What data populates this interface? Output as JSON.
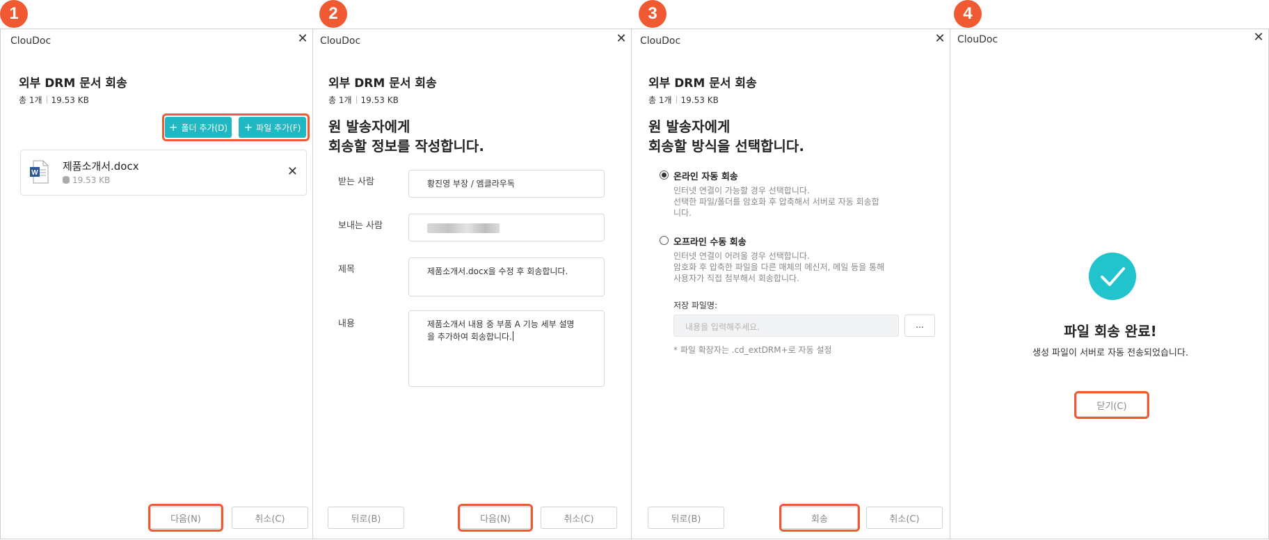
{
  "steps": [
    "1",
    "2",
    "3",
    "4"
  ],
  "app_title": "ClouDoc",
  "close_glyph": "✕",
  "dialog_title": "외부 DRM 문서 회송",
  "summary": {
    "count": "총 1개",
    "size": "19.53 KB"
  },
  "panel1": {
    "add_folder": "폴더 추가(D)",
    "add_file": "파일 추가(F)",
    "file": {
      "name": "제품소개서.docx",
      "size": "19.53 KB",
      "icon": "word-doc-icon"
    },
    "next": "다음(N)",
    "cancel": "취소(C)"
  },
  "panel2": {
    "heading_line1": "원 발송자에게",
    "heading_line2": "회송할 정보를 작성합니다.",
    "fields": [
      {
        "label": "받는 사람",
        "value": "황진영 부장 / 엠클라우독"
      },
      {
        "label": "보내는 사람",
        "value": ""
      },
      {
        "label": "제목",
        "value": "제품소개서.docx을 수정 후 회송합니다."
      },
      {
        "label": "내용",
        "value_line1": "제품소개서 내용 중 부품 A 기능 세부 설명",
        "value_line2": "을 추가하여 회송합니다."
      }
    ],
    "back": "뒤로(B)",
    "next": "다음(N)",
    "cancel": "취소(C)"
  },
  "panel3": {
    "heading_line1": "원 발송자에게",
    "heading_line2": "회송할 방식을 선택합니다.",
    "online": {
      "title": "온라인 자동 회송",
      "desc1": "인터넷 연결이 가능할 경우 선택합니다.",
      "desc2": "선택한 파일/폴더를 암호화 후 압축해서 서버로 자동 회송합",
      "desc3": "니다.",
      "selected": true
    },
    "offline": {
      "title": "오프라인 수동 회송",
      "desc1": "인터넷 연결이 어려울 경우 선택합니다.",
      "desc2": "암호화 후 압축한 파일을 다른 매체의 메신저, 메일 등을 통해",
      "desc3": "사용자가 직접 첨부해서 회송합니다.",
      "selected": false
    },
    "save_label": "저장 파일명:",
    "save_placeholder": "내용을 입력해주세요.",
    "browse": "...",
    "note": "* 파일 확장자는 .cd_extDRM+로 자동 설정",
    "back": "뒤로(B)",
    "send": "회송",
    "cancel": "취소(C)"
  },
  "panel4": {
    "title": "파일 회송 완료!",
    "subtitle": "생성 파일이 서버로 자동 전송되었습니다.",
    "close": "닫기(C)"
  },
  "colors": {
    "accent": "#21b7c3",
    "highlight": "#f05a32",
    "success": "#21c4cc"
  }
}
